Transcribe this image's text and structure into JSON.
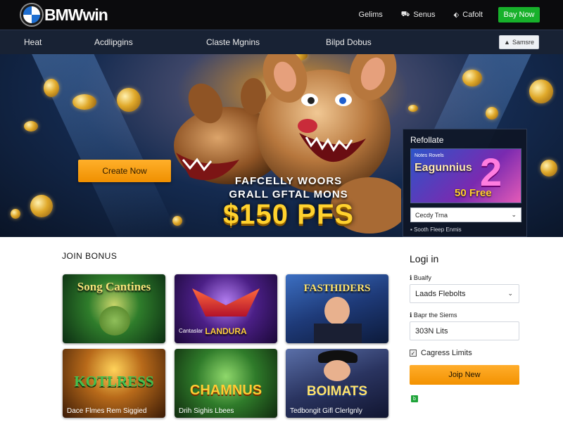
{
  "header": {
    "logo_text": "BMWwin",
    "links": [
      {
        "label": "Gelims",
        "icon": "none"
      },
      {
        "label": "Senus",
        "icon": "gift-icon"
      },
      {
        "label": "Cafolt",
        "icon": "coin-icon"
      }
    ],
    "play_label": "Bay Now"
  },
  "nav": {
    "items": [
      "Heat",
      "Acdlipgins",
      "Claste Mgnins",
      "Bilpd Dobus"
    ],
    "search_label": "Samsre"
  },
  "hero": {
    "cta_label": "Create Now",
    "promo_line1": "FAFCELLY WOORS",
    "promo_line2": "GRALL GFTAL MONS",
    "promo_amount": "$150 PFS"
  },
  "side_panel": {
    "title": "Refollate",
    "banner_small": "Notes Rovels",
    "banner_title": "Eagunnius",
    "banner_number": "2",
    "banner_offer": "50 Free",
    "select_value": "Cecdy Trna",
    "footer": "Sooth Fleep Enmis"
  },
  "section": {
    "title": "JOIN BONUS"
  },
  "games": [
    {
      "name": "Song Cantines",
      "caption": ""
    },
    {
      "name": "LANDURA",
      "caption": "Cantaslar"
    },
    {
      "name": "FASTHIDERS",
      "caption": ""
    },
    {
      "name": "KOTLRESS",
      "caption": "Dace Flmes Rem Siggied"
    },
    {
      "name": "CHAMNUS",
      "caption": "Drih Sighis Lbees"
    },
    {
      "name": "BOIMATS",
      "caption": "Tedbongit Gifl Clerlgnly"
    }
  ],
  "login": {
    "title": "Logi in",
    "field1_label": "Bualfy",
    "field1_value": "Laads Flebolts",
    "field2_label": "Bapr the Siems",
    "field2_value": "303N Lits",
    "checkbox_label": "Cagress Limits",
    "join_label": "Joip New",
    "badge_icon": "b"
  },
  "colors": {
    "accent_orange": "#f39200",
    "accent_green": "#17b12b",
    "nav_bg": "#182234",
    "top_bg": "#0b0b0d"
  }
}
